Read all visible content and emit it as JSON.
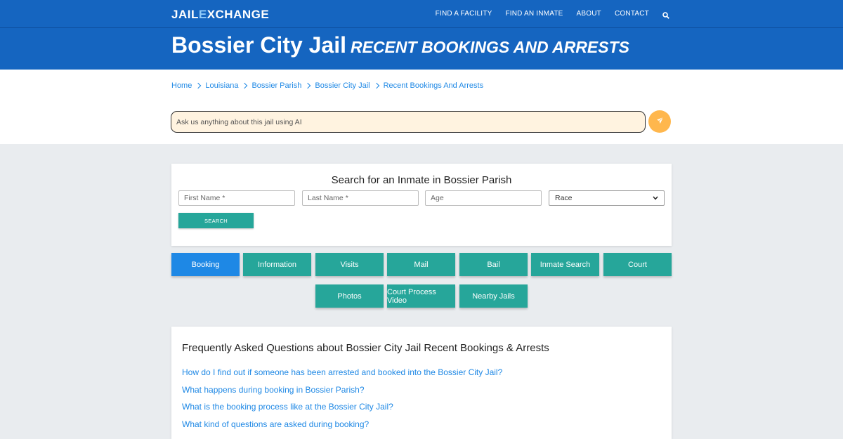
{
  "header": {
    "logo_part1": "JAIL",
    "logo_part2": "E",
    "logo_part3": "XCHANGE",
    "nav": [
      "FIND A FACILITY",
      "FIND AN INMATE",
      "ABOUT",
      "CONTACT"
    ],
    "title_main": "Bossier City Jail",
    "title_sub": "RECENT BOOKINGS AND ARRESTS"
  },
  "breadcrumb": [
    "Home",
    "Louisiana",
    "Bossier Parish",
    "Bossier City Jail",
    "Recent Bookings And Arrests"
  ],
  "ai": {
    "placeholder": "Ask us anything about this jail using AI"
  },
  "search": {
    "title": "Search for an Inmate in Bossier Parish",
    "first_name_placeholder": "First Name *",
    "last_name_placeholder": "Last Name *",
    "age_placeholder": "Age",
    "race_selected": "Race",
    "button": "SEARCH"
  },
  "tabs": [
    "Booking",
    "Information",
    "Visits",
    "Mail",
    "Bail",
    "Inmate Search",
    "Court",
    "Photos",
    "Court Process Video",
    "Nearby Jails"
  ],
  "faq": {
    "title": "Frequently Asked Questions about Bossier City Jail Recent Bookings & Arrests",
    "questions": [
      "How do I find out if someone has been arrested and booked into the Bossier City Jail?",
      "What happens during booking in Bossier Parish?",
      "What is the booking process like at the Bossier City Jail?",
      "What kind of questions are asked during booking?"
    ]
  },
  "colors": {
    "header_blue": "#1565c0",
    "link_blue": "#1e88e5",
    "teal": "#26a69a",
    "ai_button": "#ffb74d"
  }
}
